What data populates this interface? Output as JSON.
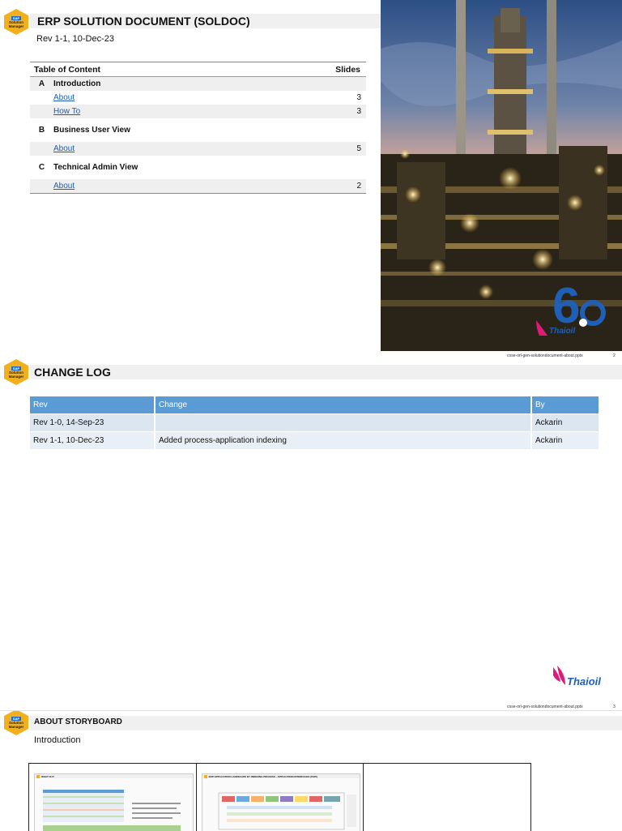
{
  "slide1": {
    "title": "ERP SOLUTION DOCUMENT (SOLDOC)",
    "revision": "Rev 1-1, 10-Dec-23",
    "toc": {
      "header_left": "Table of Content",
      "header_right": "Slides",
      "sections": [
        {
          "letter": "A",
          "title": "Introduction",
          "items": [
            {
              "label": "About",
              "slides": "3"
            },
            {
              "label": "How To",
              "slides": "3"
            }
          ]
        },
        {
          "letter": "B",
          "title": "Business User View",
          "items": [
            {
              "label": "About",
              "slides": "5"
            }
          ]
        },
        {
          "letter": "C",
          "title": "Technical Admin View",
          "items": [
            {
              "label": "About",
              "slides": "2"
            }
          ]
        }
      ]
    },
    "footer_file": "cose-orl-gen-solutiondocument-about.pptx",
    "page_number": "2"
  },
  "logo": {
    "sap": "SAP",
    "line2": "Solution",
    "line3": "Manager"
  },
  "brand": {
    "name": "Thaioil",
    "accent": "#e01a79",
    "blue": "#1f5fb6"
  },
  "slide2": {
    "title": "CHANGE LOG",
    "columns": [
      "Rev",
      "Change",
      "By"
    ],
    "rows": [
      [
        "Rev 1-0, 14-Sep-23",
        "",
        "Ackarin"
      ],
      [
        "Rev 1-1, 10-Dec-23",
        "Added process-application indexing",
        "Ackarin"
      ]
    ],
    "footer_file": "cose-orl-gen-solutiondocument-about.pptx",
    "page_number": "3"
  },
  "slide3": {
    "title": "ABOUT STORYBOARD",
    "subtitle": "Introduction",
    "thumb1_title": "WHAT IS IT",
    "thumb2_title": "ERP APPLICATION LANDSCAPE BY INDEXING PROCESS - APPLICATION INTERFACES (PAPI)"
  }
}
